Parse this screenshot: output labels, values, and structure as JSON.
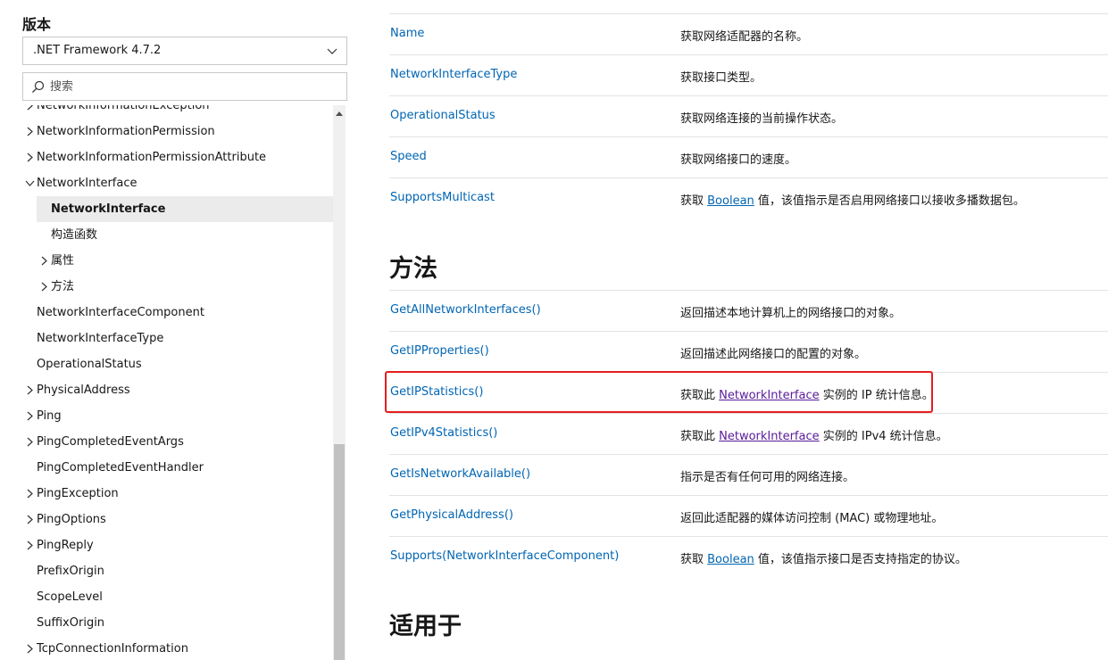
{
  "sidebar": {
    "version_label": "版本",
    "version_value": ".NET Framework 4.7.2",
    "search_placeholder": "搜索",
    "toc": [
      {
        "label": "NetworkInformationException",
        "chevron": "right",
        "indent": 0
      },
      {
        "label": "NetworkInformationPermission",
        "chevron": "right",
        "indent": 0
      },
      {
        "label": "NetworkInformationPermissionAttribute",
        "chevron": "right",
        "indent": 0
      },
      {
        "label": "NetworkInterface",
        "chevron": "down",
        "indent": 0
      },
      {
        "label": "NetworkInterface",
        "chevron": "none",
        "indent": 1,
        "selected": true
      },
      {
        "label": "构造函数",
        "chevron": "none",
        "indent": 1
      },
      {
        "label": "属性",
        "chevron": "right",
        "indent": 1
      },
      {
        "label": "方法",
        "chevron": "right",
        "indent": 1
      },
      {
        "label": "NetworkInterfaceComponent",
        "chevron": "none",
        "indent": 0
      },
      {
        "label": "NetworkInterfaceType",
        "chevron": "none",
        "indent": 0
      },
      {
        "label": "OperationalStatus",
        "chevron": "none",
        "indent": 0
      },
      {
        "label": "PhysicalAddress",
        "chevron": "right",
        "indent": 0
      },
      {
        "label": "Ping",
        "chevron": "right",
        "indent": 0
      },
      {
        "label": "PingCompletedEventArgs",
        "chevron": "right",
        "indent": 0
      },
      {
        "label": "PingCompletedEventHandler",
        "chevron": "none",
        "indent": 0
      },
      {
        "label": "PingException",
        "chevron": "right",
        "indent": 0
      },
      {
        "label": "PingOptions",
        "chevron": "right",
        "indent": 0
      },
      {
        "label": "PingReply",
        "chevron": "right",
        "indent": 0
      },
      {
        "label": "PrefixOrigin",
        "chevron": "none",
        "indent": 0
      },
      {
        "label": "ScopeLevel",
        "chevron": "none",
        "indent": 0
      },
      {
        "label": "SuffixOrigin",
        "chevron": "none",
        "indent": 0
      },
      {
        "label": "TcpConnectionInformation",
        "chevron": "right",
        "indent": 0
      }
    ]
  },
  "properties": [
    {
      "name": "Name",
      "desc": "获取网络适配器的名称。"
    },
    {
      "name": "NetworkInterfaceType",
      "desc": "获取接口类型。"
    },
    {
      "name": "OperationalStatus",
      "desc": "获取网络连接的当前操作状态。"
    },
    {
      "name": "Speed",
      "desc": "获取网络接口的速度。"
    },
    {
      "name": "SupportsMulticast",
      "desc_pre": "获取 ",
      "desc_link": "Boolean",
      "desc_post": " 值，该值指示是否启用网络接口以接收多播数据包。"
    }
  ],
  "methods_heading": "方法",
  "methods": [
    {
      "name": "GetAllNetworkInterfaces()",
      "desc": "返回描述本地计算机上的网络接口的对象。"
    },
    {
      "name": "GetIPProperties()",
      "desc": "返回描述此网络接口的配置的对象。"
    },
    {
      "name": "GetIPStatistics()",
      "desc_pre": "获取此 ",
      "desc_link": "NetworkInterface",
      "desc_post": " 实例的 IP 统计信息。",
      "highlighted": true
    },
    {
      "name": "GetIPv4Statistics()",
      "desc_pre": "获取此 ",
      "desc_link": "NetworkInterface",
      "desc_post": " 实例的 IPv4 统计信息。"
    },
    {
      "name": "GetIsNetworkAvailable()",
      "desc": "指示是否有任何可用的网络连接。"
    },
    {
      "name": "GetPhysicalAddress()",
      "desc": "返回此适配器的媒体访问控制 (MAC) 或物理地址。"
    },
    {
      "name": "Supports(NetworkInterfaceComponent)",
      "desc_pre": "获取 ",
      "desc_link": "Boolean",
      "desc_post": " 值，该值指示接口是否支持指定的协议。"
    }
  ],
  "applies_heading": "适用于",
  "colors": {
    "link": "#0065b3",
    "visited_link": "#5a1a9a",
    "highlight": "#e41e1e",
    "selected_bg": "#ebebeb"
  }
}
